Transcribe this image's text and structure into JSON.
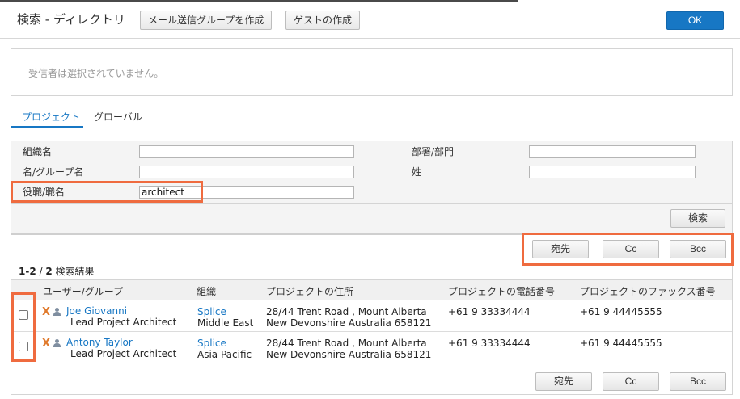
{
  "header": {
    "title": "検索 - ディレクトリ",
    "create_group_label": "メール送信グループを作成",
    "create_guest_label": "ゲストの作成",
    "ok_label": "OK"
  },
  "recipients": {
    "empty_text": "受信者は選択されていません。"
  },
  "tabs": [
    {
      "label": "プロジェクト",
      "active": true
    },
    {
      "label": "グローバル",
      "active": false
    }
  ],
  "search_form": {
    "fields": {
      "organization": {
        "label": "組織名",
        "value": ""
      },
      "department": {
        "label": "部署/部門",
        "value": ""
      },
      "name": {
        "label": "名/グループ名",
        "value": ""
      },
      "surname": {
        "label": "姓",
        "value": ""
      },
      "title": {
        "label": "役職/職名",
        "value": "architect"
      }
    },
    "search_label": "検索"
  },
  "actions": {
    "to_label": "宛先",
    "cc_label": "Cc",
    "bcc_label": "Bcc"
  },
  "results": {
    "count_range": "1-2",
    "count_sep": " / ",
    "count_total": "2",
    "count_suffix": " 検索結果",
    "columns": [
      "ユーザー/グループ",
      "組織",
      "プロジェクトの住所",
      "プロジェクトの電話番号",
      "プロジェクトのファックス番号"
    ],
    "rows": [
      {
        "icon": "x-icon",
        "name": "Joe Giovanni",
        "role": "Lead Project Architect",
        "org": "Splice",
        "region": "Middle East",
        "address1": "28/44 Trent Road , Mount Alberta",
        "address2": "New Devonshire Australia 658121",
        "phone": "+61 9 33334444",
        "fax": "+61 9 44445555"
      },
      {
        "icon": "x-icon",
        "name": "Antony Taylor",
        "role": "Lead Project Architect",
        "org": "Splice",
        "region": "Asia Pacific",
        "address1": "28/44 Trent Road , Mount Alberta",
        "address2": "New Devonshire Australia 658121",
        "phone": "+61 9 33334444",
        "fax": "+61 9 44445555"
      }
    ]
  },
  "colors": {
    "accent": "#1777c4",
    "highlight": "#ef6b3f",
    "vendor_icon": "#e07a2c"
  }
}
